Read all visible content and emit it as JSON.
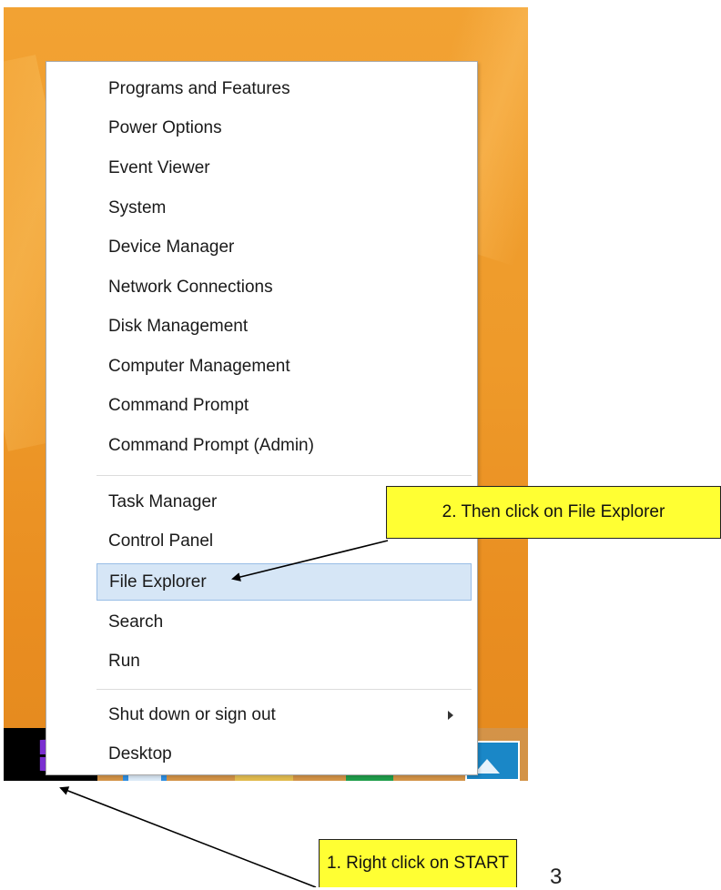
{
  "context_menu": {
    "group1": [
      "Programs and Features",
      "Power Options",
      "Event Viewer",
      "System",
      "Device Manager",
      "Network Connections",
      "Disk Management",
      "Computer Management",
      "Command Prompt",
      "Command Prompt (Admin)"
    ],
    "group2": [
      "Task Manager",
      "Control Panel",
      "File Explorer",
      "Search",
      "Run"
    ],
    "group3": [
      "Shut down or sign out",
      "Desktop"
    ],
    "highlighted_item": "File Explorer"
  },
  "callouts": {
    "step1": "1. Right click on START",
    "step2": "2. Then click on File Explorer"
  },
  "page_number": "3",
  "taskbar": {
    "icons": [
      "windows-start-icon",
      "internet-explorer-icon",
      "file-explorer-icon",
      "store-icon",
      "photos-icon"
    ]
  },
  "colors": {
    "desktop_background": "#ee9a2a",
    "callout_background": "#ffff33",
    "menu_highlight": "#d6e6f6",
    "start_logo": "#7a2fd0"
  }
}
